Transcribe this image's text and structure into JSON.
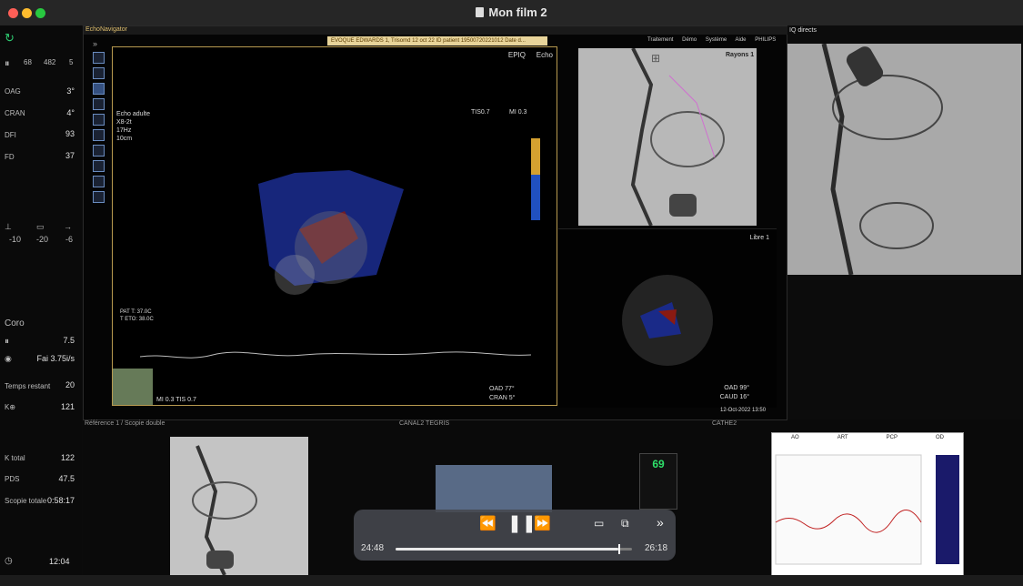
{
  "window": {
    "title": "Mon film 2",
    "colors": {
      "close": "#ff5f57",
      "min": "#febc2e",
      "max": "#28c840"
    }
  },
  "left_panel": {
    "stats": {
      "a": "68",
      "b": "482",
      "c": "5"
    },
    "rows": [
      {
        "label": "OAG",
        "value": "3°"
      },
      {
        "label": "CRAN",
        "value": "4°"
      },
      {
        "label": "DFI",
        "value": "93"
      },
      {
        "label": "FD",
        "value": "37"
      }
    ],
    "table_vals": [
      "-10",
      "-20",
      "-6"
    ],
    "coro_title": "Coro",
    "coro_val": "7.5",
    "fai_val": "Fai 3.75i/s",
    "temps_label": "Temps restant",
    "temps_val": "20",
    "k_val": "121",
    "k_total_label": "K total",
    "k_total_val": "122",
    "pds_label": "PDS",
    "pds_val": "47.5",
    "scopie_label": "Scopie totale",
    "scopie_val": "0:58:17",
    "clock": "12:04"
  },
  "main": {
    "header": "EchoNavigator",
    "patient_bar": "EVOQUE EDWARDS 1, Trisomd 12 oct 22   ID patient 19500720221012   Date d...",
    "menu": [
      "Traitement",
      "Démo",
      "Système",
      "Aide",
      "PHILIPS"
    ],
    "epiq": "EPIQ",
    "echo": "Echo",
    "tis": "TIS0.7",
    "mi": "MI 0.3",
    "mode": "Echo adulte",
    "probe": "X8-2t",
    "freq": "17Hz",
    "depth": "10cm",
    "pat": "PAT T: 37.0C",
    "tto": "T ETO: 38.0C",
    "mi_bottom": "MI 0.3   TIS 0.7",
    "oad": "OAD 77°",
    "cran": "CRAN 5°",
    "rayons": "Rayons 1",
    "libre": "Libre 1",
    "oad2": "OAD 99°",
    "caud": "CAUD 16°",
    "date": "12-Oct-2022 13:50"
  },
  "right": {
    "header": "IQ directs"
  },
  "bottom": {
    "ref": "Référence 1 / Scopie double",
    "canal": "CANAL2 TEGRIS",
    "cathe": "CATHE2",
    "monitor_val": "69",
    "hemo_cols": [
      "AO",
      "ART",
      "PCP",
      "OD"
    ]
  },
  "player": {
    "current": "24:48",
    "total": "26:18",
    "progress": 0.944
  }
}
